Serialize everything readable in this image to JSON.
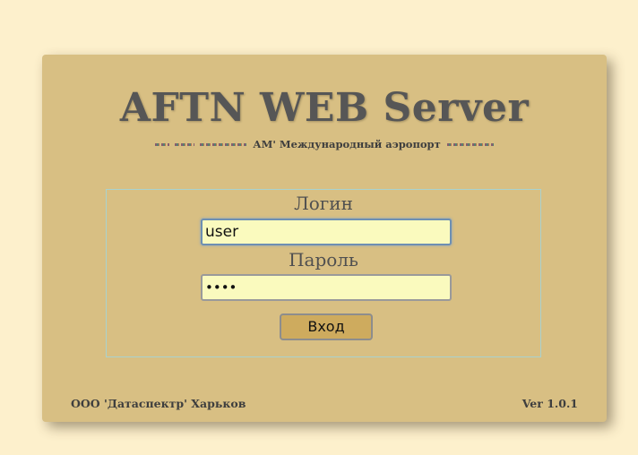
{
  "app": {
    "title": "AFTN WEB Server",
    "subtitle": "АМ' Международный аэропорт"
  },
  "login_form": {
    "login_label": "Логин",
    "login_value": "user",
    "password_label": "Пароль",
    "password_value": "user",
    "submit_label": "Вход"
  },
  "footer": {
    "company": "ООО 'Датаспектр' Харьков",
    "version": "Ver 1.0.1"
  },
  "colors": {
    "page_background": "#fdf0cc",
    "card_background": "#d8bf83",
    "input_background": "#fafabe",
    "button_background": "#ceab5e",
    "title_text": "#565656"
  }
}
